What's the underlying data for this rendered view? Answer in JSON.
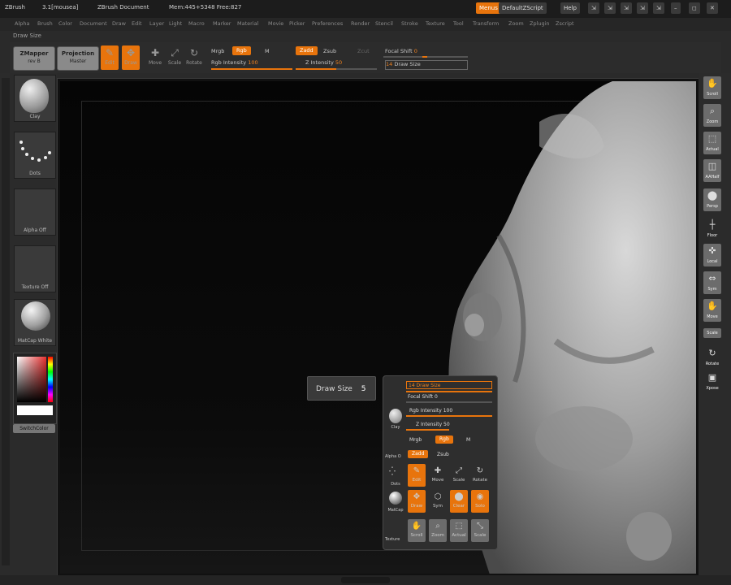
{
  "titlebar": {
    "app": "ZBrush",
    "version": "3.1[mousea]",
    "document": "ZBrush Document",
    "memory": "Mem:445+5348 Free:827",
    "menus_btn": "Menus",
    "script_btn": "DefaultZScript",
    "help_btn": "Help"
  },
  "menubar": [
    "Alpha",
    "Brush",
    "Color",
    "Document",
    "Draw",
    "Edit",
    "Layer",
    "Light",
    "Macro",
    "Marker",
    "Material",
    "Movie",
    "Picker",
    "Preferences",
    "Render",
    "Stencil",
    "Stroke",
    "Texture",
    "Tool",
    "Transform",
    "Zoom",
    "Zplugin",
    "Zscript"
  ],
  "palette_name": "Draw Size",
  "shelf": {
    "zmapper": "ZMapper",
    "zmapper_sub": "rev B",
    "projection": "Projection",
    "projection_sub": "Master",
    "tools": [
      {
        "icon": "✎",
        "label": "Edit",
        "active": true
      },
      {
        "icon": "✥",
        "label": "Draw",
        "active": true
      },
      {
        "icon": "✚",
        "label": "Move",
        "active": false
      },
      {
        "icon": "⤢",
        "label": "Scale",
        "active": false
      },
      {
        "icon": "↻",
        "label": "Rotate",
        "active": false
      }
    ],
    "mrgb": "Mrgb",
    "rgb": "Rgb",
    "m": "M",
    "rgb_intensity_label": "Rgb Intensity",
    "rgb_intensity_value": "100",
    "zadd": "Zadd",
    "zsub": "Zsub",
    "zcut": "Zcut",
    "z_intensity_label": "Z Intensity",
    "z_intensity_value": "50",
    "focal_label": "Focal Shift",
    "focal_value": "0",
    "drawsize_label": "Draw Size",
    "drawsize_value": "14"
  },
  "leftshelf": {
    "items": [
      {
        "label": "Clay",
        "kind": "sphere"
      },
      {
        "label": "Dots",
        "kind": "dots"
      },
      {
        "label": "Alpha Off",
        "kind": "empty"
      },
      {
        "label": "Texture Off",
        "kind": "empty"
      },
      {
        "label": "MatCap White",
        "kind": "sphere"
      }
    ],
    "switch_color": "SwitchColor"
  },
  "rightshelf": [
    {
      "label": "Scroll",
      "icon": "✋"
    },
    {
      "label": "Zoom",
      "icon": "🔍"
    },
    {
      "label": "Actual",
      "icon": "⬚"
    },
    {
      "label": "AAHalf",
      "icon": "◫"
    },
    {
      "label": "Persp",
      "icon": "⬤"
    },
    {
      "label": "Floor",
      "icon": "┼"
    },
    {
      "label": "Local",
      "icon": "✜"
    },
    {
      "label": "Sym",
      "icon": "⇔"
    },
    {
      "label": "Move",
      "icon": "✋"
    },
    {
      "label": "Scale",
      "icon": "⤡"
    },
    {
      "label": "Rotate",
      "icon": "↻"
    },
    {
      "label": "Xpose",
      "icon": "▣"
    }
  ],
  "drawsize_tip": {
    "label": "Draw Size",
    "value": "5"
  },
  "popup": {
    "drawsize": "14 Draw Size",
    "focal": "Focal Shift 0",
    "rgb_int": "Rgb Intensity 100",
    "z_int": "Z Intensity 50",
    "mrgb": "Mrgb",
    "rgb": "Rgb",
    "m": "M",
    "zadd": "Zadd",
    "zsub": "Zsub",
    "clay": "Clay",
    "alpha": "Alpha O",
    "dots": "Dots",
    "matcap": "MatCap",
    "texture": "Texture",
    "edit": "Edit",
    "draw": "Draw",
    "move": "Move",
    "scale": "Scale",
    "rotate": "Rotate",
    "sym": "Sym",
    "clear": "Clear",
    "solo": "Solo",
    "scroll": "Scroll",
    "zoom": "Zoom",
    "actual": "Actual"
  },
  "colors": {
    "accent": "#e8740c",
    "panel": "#2b2b2b",
    "canvas": "#080808"
  }
}
